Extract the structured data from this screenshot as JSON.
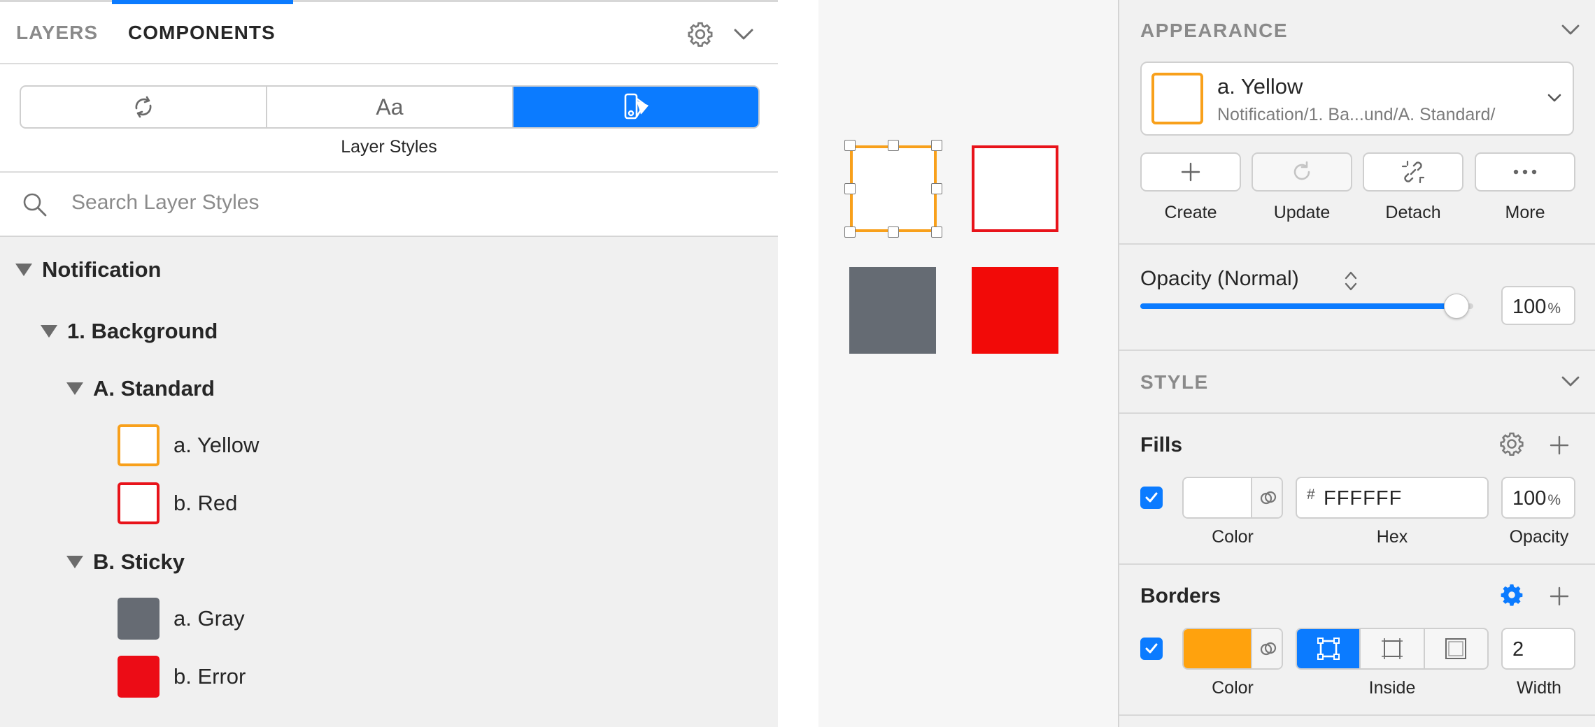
{
  "left_panel": {
    "tabs": [
      {
        "label": "LAYERS",
        "active": false
      },
      {
        "label": "COMPONENTS",
        "active": true
      }
    ],
    "segments": [
      {
        "icon": "sync-icon",
        "label": "Aa",
        "active": false
      },
      {
        "icon": "text-styles-icon",
        "label": "Aa",
        "active": false
      },
      {
        "icon": "layer-styles-icon",
        "label": "",
        "active": true
      }
    ],
    "segment_caption": "Layer Styles",
    "search": {
      "placeholder": "Search Layer Styles",
      "value": ""
    },
    "tree": {
      "root": "Notification",
      "group1": "1. Background",
      "subgroup_a": "A. Standard",
      "items_a": [
        {
          "label": "a. Yellow",
          "border": "#f8a01b",
          "fill": "#ffffff"
        },
        {
          "label": "b. Red",
          "border": "#e8131a",
          "fill": "#ffffff"
        }
      ],
      "subgroup_b": "B. Sticky",
      "items_b": [
        {
          "label": "a. Gray",
          "border": "#666b73",
          "fill": "#666b73"
        },
        {
          "label": "b. Error",
          "border": "#ec0c16",
          "fill": "#ec0c16"
        }
      ]
    }
  },
  "canvas": {
    "shapes": [
      {
        "name": "yellow",
        "fill": "#ffffff",
        "border": "#f8a01b",
        "selected": true
      },
      {
        "name": "red",
        "fill": "#ffffff",
        "border": "#e8131a",
        "selected": false
      },
      {
        "name": "gray",
        "fill": "#656b73",
        "border": "#656b73",
        "selected": false
      },
      {
        "name": "error",
        "fill": "#f20a08",
        "border": "#f20a08",
        "selected": false
      }
    ]
  },
  "inspector": {
    "appearance_title": "APPEARANCE",
    "style_name": "a. Yellow",
    "style_path": "Notification/1. Ba...und/A. Standard/",
    "style_border_color": "#f8a01b",
    "actions": [
      {
        "label": "Create",
        "icon": "plus-icon",
        "enabled": true
      },
      {
        "label": "Update",
        "icon": "refresh-icon",
        "enabled": false
      },
      {
        "label": "Detach",
        "icon": "unlink-icon",
        "enabled": true
      },
      {
        "label": "More",
        "icon": "more-icon",
        "enabled": true
      }
    ],
    "opacity_label": "Opacity (Normal)",
    "opacity_value": "100",
    "opacity_unit": "%",
    "opacity_fraction": 0.95,
    "style_title": "STYLE",
    "fills": {
      "title": "Fills",
      "enabled": true,
      "color": "#ffffff",
      "hex_prefix": "#",
      "hex": "FFFFFF",
      "opacity": "100",
      "opacity_unit": "%",
      "labels": {
        "color": "Color",
        "hex": "Hex",
        "opacity": "Opacity"
      }
    },
    "borders": {
      "title": "Borders",
      "enabled": true,
      "color": "#ffa20d",
      "position": "Inside",
      "width": "2",
      "labels": {
        "color": "Color",
        "position": "Inside",
        "width": "Width"
      }
    },
    "accent": "#0b7bff"
  }
}
